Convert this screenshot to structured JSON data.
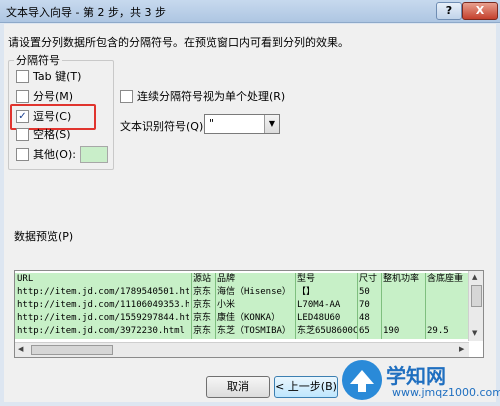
{
  "window": {
    "title": "文本导入向导 - 第 2 步，共 3 步",
    "help": "?",
    "close": "X"
  },
  "instruction": "请设置分列数据所包含的分隔符号。在预览窗口内可看到分列的效果。",
  "delimiters": {
    "group_label": "分隔符号",
    "options": [
      {
        "label": "Tab 键(T)",
        "checked": false
      },
      {
        "label": "分号(M)",
        "checked": false
      },
      {
        "label": "逗号(C)",
        "checked": true
      },
      {
        "label": "空格(S)",
        "checked": false
      },
      {
        "label": "其他(O):",
        "checked": false
      }
    ],
    "checkmark": "✓"
  },
  "merge_delimiters": {
    "label": "连续分隔符号视为单个处理(R)",
    "checked": false
  },
  "text_qualifier": {
    "label": "文本识别符号(Q):",
    "value": "\"",
    "arrow": "▼"
  },
  "preview": {
    "label": "数据预览(P)",
    "columns": [
      "URL",
      "源站",
      "品牌",
      "型号",
      "尺寸",
      "整机功率",
      "含底座重"
    ],
    "rows": [
      [
        "http://item.jd.com/1789540501.html",
        "京东",
        "海信（Hisense）",
        "【】",
        "50",
        "",
        ""
      ],
      [
        "http://item.jd.com/11106049353.html",
        "京东",
        "小米",
        "L70M4-AA",
        "70",
        "",
        ""
      ],
      [
        "http://item.jd.com/1559297844.html",
        "京东",
        "康佳（KONKA）",
        "LED48U60",
        "48",
        "",
        ""
      ],
      [
        "http://item.jd.com/3972230.html",
        "京东",
        "东芝（TOSMIBA）",
        "东芝65U8600C",
        "65",
        "190",
        "29.5"
      ]
    ]
  },
  "buttons": {
    "cancel": "取消",
    "back": "< 上一步(B)"
  },
  "watermark": {
    "text": "学知网",
    "url": "www.jmqz1000.com"
  }
}
